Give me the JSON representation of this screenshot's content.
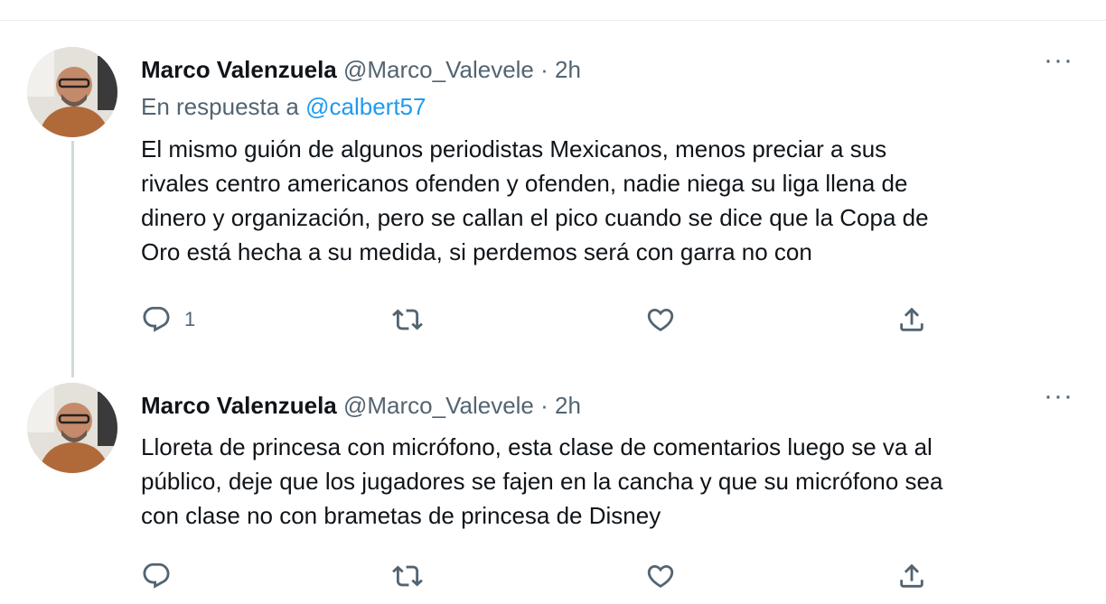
{
  "tweets": [
    {
      "name": "Marco Valenzuela",
      "handle": "@Marco_Valevele",
      "separator": "·",
      "time": "2h",
      "more": "···",
      "reply_prefix": "En respuesta a",
      "reply_mention": "@calbert57",
      "text_lines": [
        "El mismo guión de algunos periodistas Mexicanos, menos preciar a sus",
        "rivales centro americanos ofenden y ofenden, nadie niega su liga llena de",
        "dinero y organización, pero se callan el pico cuando se dice que la Copa de",
        "Oro está hecha a su medida, si perdemos será con garra no con"
      ],
      "reply_count": "1"
    },
    {
      "name": "Marco Valenzuela",
      "handle": "@Marco_Valevele",
      "separator": "·",
      "time": "2h",
      "more": "···",
      "text_lines": [
        "Lloreta de princesa con micrófono, esta clase de comentarios luego se va al",
        "público, deje que los jugadores se fajen en la cancha y que su micrófono sea",
        "con clase no con brametas de princesa de Disney"
      ]
    }
  ],
  "icons": {
    "reply": "reply-icon",
    "retweet": "retweet-icon",
    "like": "heart-icon",
    "share": "share-icon",
    "more": "more-icon"
  },
  "colors": {
    "link": "#1d9bf0",
    "secondary": "#536471",
    "thread_line": "#cfd9de"
  }
}
